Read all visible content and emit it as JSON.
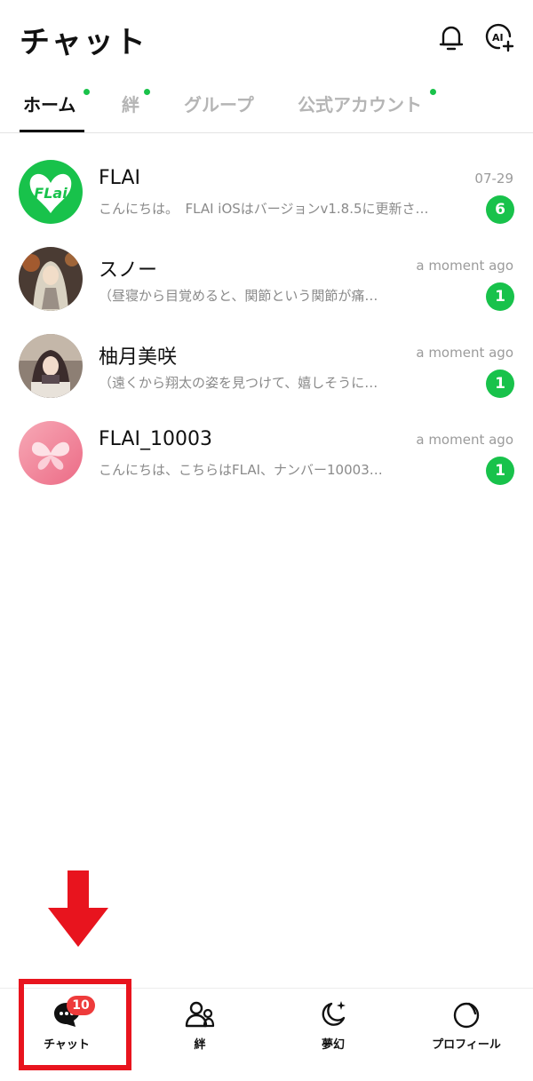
{
  "header": {
    "title": "チャット",
    "icons": [
      "bell-icon",
      "ai-add-icon"
    ]
  },
  "tabs": [
    {
      "label": "ホーム",
      "active": true,
      "has_dot": true
    },
    {
      "label": "絆",
      "active": false,
      "has_dot": true
    },
    {
      "label": "グループ",
      "active": false,
      "has_dot": false
    },
    {
      "label": "公式アカウント",
      "active": false,
      "has_dot": true
    }
  ],
  "chats": [
    {
      "name": "FLAI",
      "preview": "こんにちは。　FLAI iOSはバージョンv1.8.5に更新さ…",
      "time": "07-29",
      "unread": "6",
      "avatar_logo": "FLai"
    },
    {
      "name": "スノー",
      "preview": "（昼寝から目覚めると、関節という関節が痛…",
      "time": "a moment ago",
      "unread": "1"
    },
    {
      "name": "柚月美咲",
      "preview": "（遠くから翔太の姿を見つけて、嬉しそうに…",
      "time": "a moment ago",
      "unread": "1"
    },
    {
      "name": "FLAI_10003",
      "preview": "こんにちは、こちらはFLAI、ナンバー10003…",
      "time": "a moment ago",
      "unread": "1"
    }
  ],
  "bottom_nav": [
    {
      "label": "チャット",
      "icon": "chat-bubble-icon",
      "badge": "10",
      "active": true
    },
    {
      "label": "絆",
      "icon": "people-icon"
    },
    {
      "label": "夢幻",
      "icon": "moon-sparkle-icon"
    },
    {
      "label": "プロフィール",
      "icon": "profile-circle-icon"
    }
  ],
  "colors": {
    "accent_green": "#18c24b",
    "badge_red": "#ee3b3b",
    "annotation_red": "#e8141e",
    "inactive_tab": "#b5b5b5"
  }
}
